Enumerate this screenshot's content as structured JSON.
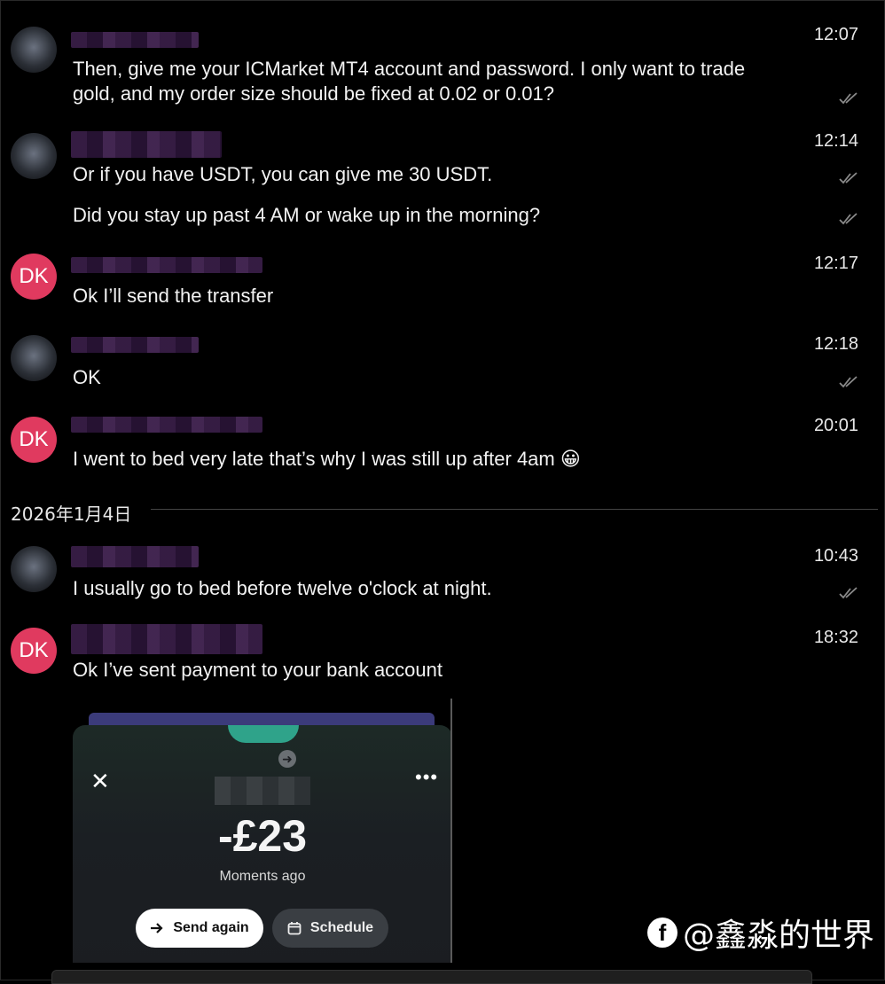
{
  "messages": [
    {
      "sender_initials": "",
      "time": "12:07",
      "lines": [
        "Then, give me your ICMarket MT4 account and password. I only want to trade",
        "gold, and my order size should be fixed at 0.02 or 0.01?"
      ]
    },
    {
      "sender_initials": "",
      "time": "12:14",
      "lines": [
        "Or if you have USDT, you can give me 30 USDT.",
        "Did you stay up past 4 AM or wake up in the morning?"
      ]
    },
    {
      "sender_initials": "DK",
      "time": "12:17",
      "lines": [
        "Ok I’ll send the transfer"
      ]
    },
    {
      "sender_initials": "",
      "time": "12:18",
      "lines": [
        "OK"
      ]
    },
    {
      "sender_initials": "DK",
      "time": "20:01",
      "lines": [
        "I went to bed very late that’s why I was still up after 4am 😀"
      ]
    },
    {
      "sender_initials": "",
      "time": "10:43",
      "lines": [
        "I usually go to bed before twelve o'clock at night."
      ]
    },
    {
      "sender_initials": "DK",
      "time": "18:32",
      "lines": [
        "Ok I’ve sent payment to your bank account"
      ]
    }
  ],
  "date_separator": "2026年1月4日",
  "payment_screenshot": {
    "amount": "-£23",
    "subtitle": "Moments ago",
    "send_again_label": "Send again",
    "schedule_label": "Schedule",
    "close_glyph": "✕",
    "more_glyph": "•••",
    "arrow_glyph": "➜"
  },
  "watermark": {
    "text": "@鑫淼的世界",
    "icon": "f"
  },
  "icons": {
    "read_check": "double-check-icon",
    "send": "arrow-right-icon",
    "schedule": "calendar-icon"
  },
  "colors": {
    "background": "#000000",
    "dk_avatar": "#e03a5f",
    "send_button": "#ffffff",
    "schedule_button": "#3a3e43"
  }
}
